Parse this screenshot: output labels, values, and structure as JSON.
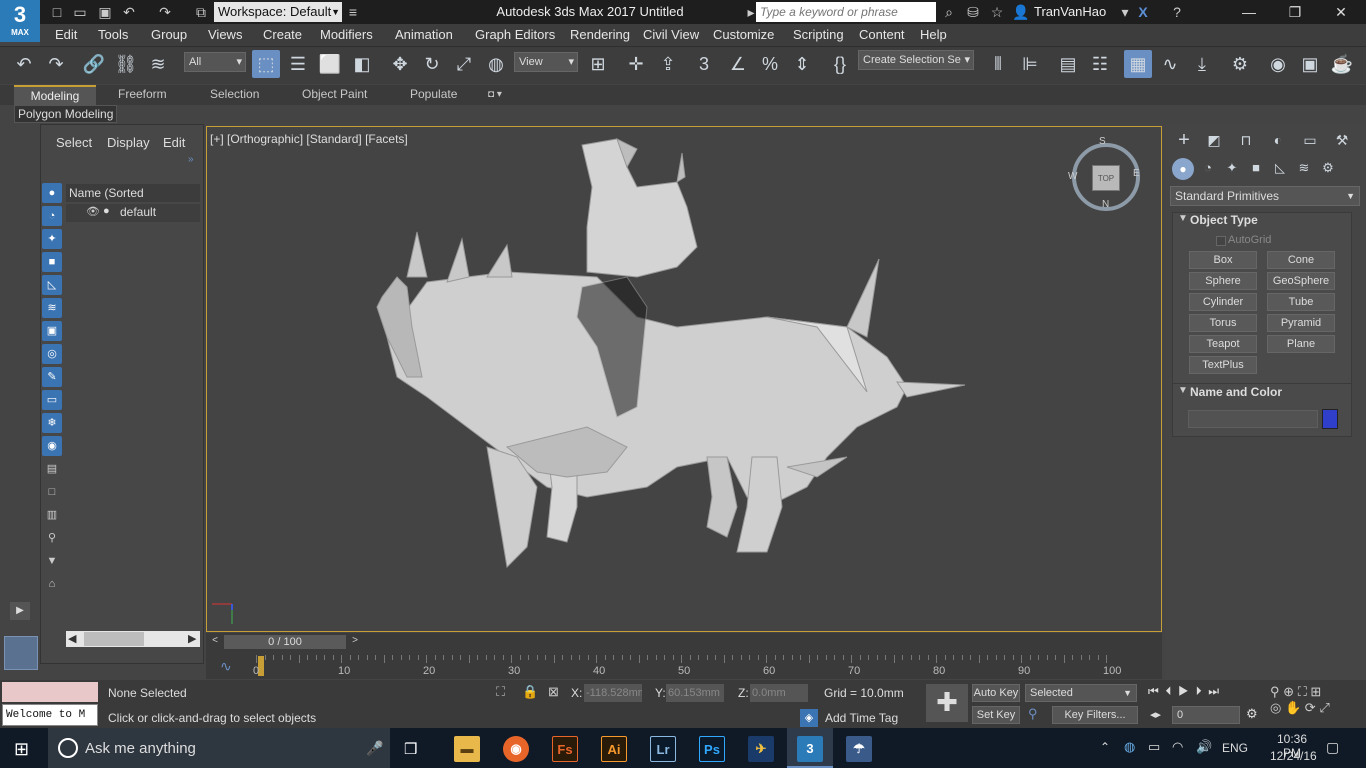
{
  "titlebar": {
    "logo": "3",
    "logo_sub": "MAX",
    "workspace": "Workspace: Default",
    "title": "Autodesk 3ds Max 2017     Untitled",
    "search_placeholder": "Type a keyword or phrase",
    "user": "TranVanHao"
  },
  "menus": [
    "Edit",
    "Tools",
    "Group",
    "Views",
    "Create",
    "Modifiers",
    "Animation",
    "Graph Editors",
    "Rendering",
    "Civil View",
    "Customize",
    "Scripting",
    "Content",
    "Help"
  ],
  "toolbar": {
    "filter": "All",
    "refcoord": "View",
    "selection_set": "Create Selection Se"
  },
  "ribbon_tabs": [
    "Modeling",
    "Freeform",
    "Selection",
    "Object Paint",
    "Populate"
  ],
  "polygon_modeling": "Polygon Modeling",
  "explorer": {
    "tabs": [
      "Select",
      "Display",
      "Edit"
    ],
    "column_header": "Name (Sorted Descending)",
    "items": [
      "default"
    ]
  },
  "viewport": {
    "label": "[+] [Orthographic] [Standard] [Facets]",
    "viewcube_face": "TOP",
    "compass": {
      "s": "S",
      "w": "W",
      "e": "E",
      "n": "N"
    }
  },
  "cmdpanel": {
    "category": "Standard Primitives",
    "object_type_title": "Object Type",
    "autogrid": "AutoGrid",
    "buttons": [
      "Box",
      "Cone",
      "Sphere",
      "GeoSphere",
      "Cylinder",
      "Tube",
      "Torus",
      "Pyramid",
      "Teapot",
      "Plane",
      "TextPlus"
    ],
    "name_color_title": "Name and Color",
    "swatch_color": "#2f3fc9"
  },
  "timeslider": {
    "frame": "0 / 100"
  },
  "track_ticks": [
    "0",
    "10",
    "20",
    "30",
    "40",
    "50",
    "60",
    "70",
    "80",
    "90",
    "100"
  ],
  "status": {
    "maxscript": "Welcome to M",
    "selection": "None Selected",
    "prompt": "Click or click-and-drag to select objects",
    "x_label": "X:",
    "x": "-118.528mm",
    "y_label": "Y:",
    "y": "60.153mm",
    "z_label": "Z:",
    "z": "0.0mm",
    "grid": "Grid = 10.0mm",
    "add_time_tag": "Add Time Tag",
    "auto_key": "Auto Key",
    "set_key": "Set Key",
    "key_mode": "Selected",
    "key_filters": "Key Filters...",
    "frame_field": "0"
  },
  "taskbar": {
    "search": "Ask me anything",
    "lang": "ENG",
    "time": "10:36 PM",
    "date": "12/24/16",
    "apps": [
      "Fs",
      "Ai",
      "Lr",
      "Ps",
      "3"
    ]
  }
}
